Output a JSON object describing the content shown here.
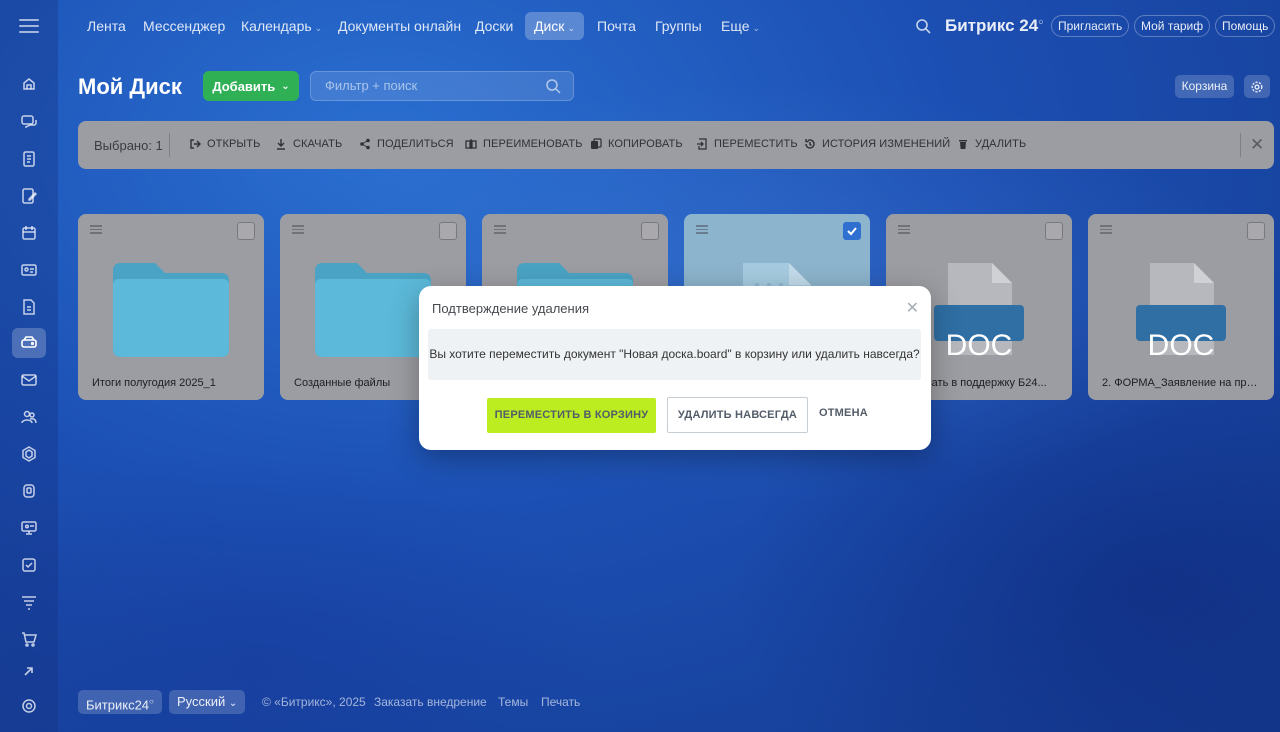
{
  "topnav": {
    "items": [
      {
        "label": "Лента"
      },
      {
        "label": "Мессенджер"
      },
      {
        "label": "Календарь"
      },
      {
        "label": "Документы онлайн"
      },
      {
        "label": "Доски"
      },
      {
        "label": "Диск"
      },
      {
        "label": "Почта"
      },
      {
        "label": "Группы"
      },
      {
        "label": "Еще"
      }
    ],
    "brand": "Битрикс 24",
    "invite": "Пригласить",
    "tariff": "Мой тариф",
    "help": "Помощь"
  },
  "page": {
    "title": "Мой Диск",
    "add_label": "Добавить",
    "filter_placeholder": "Фильтр + поиск",
    "trash_label": "Корзина"
  },
  "toolbar": {
    "selected": "Выбрано: 1",
    "actions": [
      {
        "label": "ОТКРЫТЬ",
        "icon": "open-icon"
      },
      {
        "label": "СКАЧАТЬ",
        "icon": "download-icon"
      },
      {
        "label": "ПОДЕЛИТЬСЯ",
        "icon": "share-icon"
      },
      {
        "label": "ПЕРЕИМЕНОВАТЬ",
        "icon": "rename-icon"
      },
      {
        "label": "КОПИРОВАТЬ",
        "icon": "copy-icon"
      },
      {
        "label": "ПЕРЕМЕСТИТЬ",
        "icon": "move-icon"
      },
      {
        "label": "ИСТОРИЯ ИЗМЕНЕНИЙ",
        "icon": "history-icon"
      },
      {
        "label": "УДАЛИТЬ",
        "icon": "trash-icon"
      }
    ]
  },
  "tiles": [
    {
      "name": "Итоги полугодия 2025_1",
      "kind": "folder",
      "checked": false
    },
    {
      "name": "Созданные файлы",
      "kind": "folder",
      "checked": false
    },
    {
      "name": "",
      "kind": "folder",
      "checked": false
    },
    {
      "name": "",
      "kind": "board",
      "checked": true
    },
    {
      "name": "Написать в поддержку Б24...",
      "kind": "doc",
      "checked": false,
      "badge": "DOC"
    },
    {
      "name": "2. ФОРМА_Заявление на пред...",
      "kind": "doc",
      "checked": false,
      "badge": "DOC"
    }
  ],
  "modal": {
    "title": "Подтверждение удаления",
    "message": "Вы хотите переместить документ \"Новая доска.board\" в корзину или удалить навсегда?",
    "move_label": "ПЕРЕМЕСТИТЬ В КОРЗИНУ",
    "delete_label": "УДАЛИТЬ НАВСЕГДА",
    "cancel_label": "ОТМЕНА"
  },
  "footer": {
    "brand": "Битрикс24",
    "language": "Русский",
    "copyright": "© «Битрикс», 2025",
    "order": "Заказать внедрение",
    "themes": "Темы",
    "print": "Печать"
  },
  "colors": {
    "accent_green": "#bbed21",
    "add_button": "#2fb055",
    "checkbox_blue": "#2f6fd0",
    "folder_blue": "#55b8d8"
  }
}
